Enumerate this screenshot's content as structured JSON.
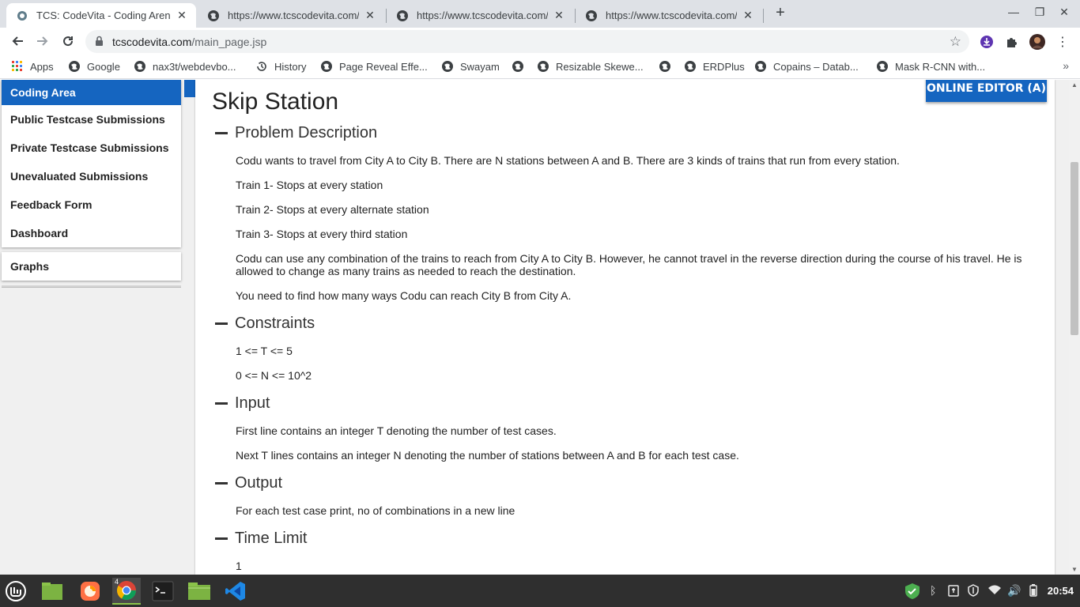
{
  "browser": {
    "tabs": [
      {
        "title": "TCS: CodeVita - Coding Arena",
        "active": true
      },
      {
        "title": "https://www.tcscodevita.com/",
        "active": false
      },
      {
        "title": "https://www.tcscodevita.com/",
        "active": false
      },
      {
        "title": "https://www.tcscodevita.com/",
        "active": false
      }
    ],
    "address": {
      "domain": "tcscodevita.com",
      "path": "/main_page.jsp"
    },
    "bookmarks": [
      "Apps",
      "Google",
      "nax3t/webdevbo...",
      "History",
      "Page Reveal Effe...",
      "Swayam",
      "",
      "Resizable Skewe...",
      "",
      "ERDPlus",
      "Copains – Datab...",
      "Mask R-CNN with..."
    ]
  },
  "sidebar": {
    "items": [
      "Coding Area",
      "Public Testcase Submissions",
      "Private Testcase Submissions",
      "Unevaluated Submissions",
      "Feedback Form",
      "Dashboard"
    ],
    "items2": [
      "Graphs"
    ]
  },
  "editor_button": "ONLINE EDITOR (A)",
  "problem": {
    "title": "Skip Station",
    "sections": {
      "description": "Problem Description",
      "constraints": "Constraints",
      "input": "Input",
      "output": "Output",
      "time_limit": "Time Limit"
    },
    "description": [
      "Codu wants to travel from City A to City B. There are N stations between A and B. There are 3 kinds of trains that run from every station.",
      "Train 1- Stops at every station",
      "Train 2- Stops at every alternate station",
      "Train 3- Stops at every third station",
      "Codu can use any combination of the trains to reach from City A to City B. However, he cannot travel in the reverse direction during the course of his travel. He is allowed to change as many trains as needed to reach the destination.",
      "You need to find how many ways Codu can reach City B from City A."
    ],
    "constraints": [
      "1 <= T <= 5",
      "0 <= N <= 10^2"
    ],
    "input": [
      "First line contains an integer T denoting the number of test cases.",
      "Next T lines contains an integer N denoting the number of stations between A and B for each test case."
    ],
    "output": [
      "For each test case print, no of combinations in a new line"
    ],
    "time_limit": "1"
  },
  "taskbar": {
    "chrome_badge": "4",
    "clock": "20:54"
  },
  "colors": {
    "accent": "#1565c0",
    "page_bg": "#f0f0f0",
    "taskbar": "#2f2f2f"
  }
}
